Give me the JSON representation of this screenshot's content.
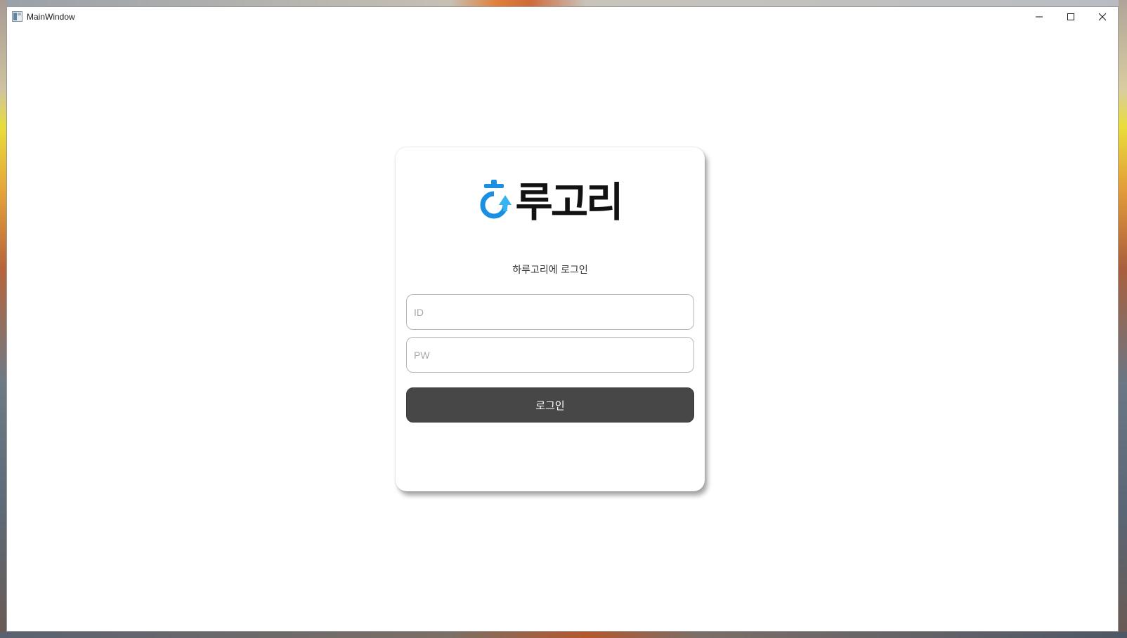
{
  "window": {
    "title": "MainWindow",
    "controls": {
      "minimize_icon": "minimize-icon",
      "maximize_icon": "maximize-icon",
      "close_icon": "close-icon"
    }
  },
  "login": {
    "logo_text": "루고리",
    "logo_initial": "ㅎ",
    "subtitle": "하루고리에 로그인",
    "id_placeholder": "ID",
    "pw_placeholder": "PW",
    "login_button": "로그인"
  },
  "colors": {
    "logo_blue": "#1a8fe3",
    "logo_dark": "#121212",
    "button_bg": "#474747"
  }
}
